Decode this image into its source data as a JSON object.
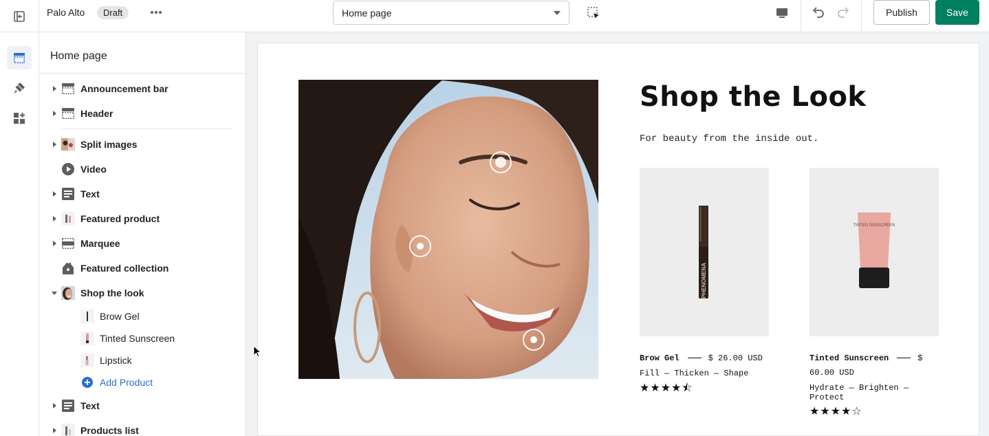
{
  "topbar": {
    "store_name": "Palo Alto",
    "status_badge": "Draft",
    "page_selector": "Home page",
    "publish_label": "Publish",
    "save_label": "Save",
    "accent": "#008060"
  },
  "rail": {
    "items": [
      {
        "icon": "sections-icon",
        "active": true
      },
      {
        "icon": "theme-settings-icon",
        "active": false
      },
      {
        "icon": "apps-icon",
        "active": false
      }
    ]
  },
  "sidebar": {
    "title": "Home page",
    "items": [
      {
        "label": "Announcement bar",
        "icon": "announcement-bar-icon",
        "expandable": true
      },
      {
        "label": "Header",
        "icon": "header-icon",
        "expandable": true
      },
      {
        "label": "Split images",
        "icon": "split-images-thumbnail",
        "expandable": true
      },
      {
        "label": "Video",
        "icon": "play-icon",
        "expandable": false
      },
      {
        "label": "Text",
        "icon": "text-icon",
        "expandable": true
      },
      {
        "label": "Featured product",
        "icon": "product-thumbnail",
        "expandable": true
      },
      {
        "label": "Marquee",
        "icon": "marquee-icon",
        "expandable": true
      },
      {
        "label": "Featured collection",
        "icon": "collection-tag-icon",
        "expandable": false
      },
      {
        "label": "Shop the look",
        "icon": "shop-the-look-thumbnail",
        "expanded": true
      },
      {
        "label": "Text",
        "icon": "text-icon",
        "expandable": true
      },
      {
        "label": "Products list",
        "icon": "products-list-thumbnail",
        "expandable": true
      }
    ],
    "sub_items": [
      {
        "label": "Brow Gel",
        "icon": "brow-gel-thumbnail"
      },
      {
        "label": "Tinted Sunscreen",
        "icon": "sunscreen-thumbnail"
      },
      {
        "label": "Lipstick",
        "icon": "lipstick-thumbnail"
      }
    ],
    "add_product_label": "Add Product"
  },
  "preview": {
    "heading": "Shop the Look",
    "subheading": "For beauty from the inside out.",
    "products": [
      {
        "name": "Brow Gel",
        "price": "$ 26.00 USD",
        "description": "Fill — Thicken — Shape",
        "rating": 4.5,
        "stars": "★★★★⯪",
        "product_label": "PHENOMENA"
      },
      {
        "name": "Tinted Sunscreen",
        "price": "$ 60.00 USD",
        "description": "Hydrate — Brighten — Protect",
        "rating": 4,
        "stars": "★★★★☆",
        "product_label": "TINTED SUNSCREEN"
      }
    ]
  }
}
